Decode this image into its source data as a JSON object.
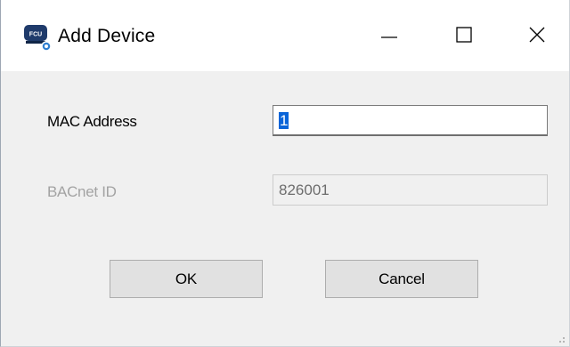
{
  "window": {
    "title": "Add Device",
    "icon_name": "fcu-device-icon",
    "icon_badge": "FCU",
    "controls": {
      "minimize_icon": "minimize-icon",
      "maximize_icon": "maximize-icon",
      "close_icon": "close-icon"
    }
  },
  "form": {
    "mac_address": {
      "label": "MAC Address",
      "value": "1"
    },
    "bacnet_id": {
      "label": "BACnet ID",
      "value": "826001"
    }
  },
  "buttons": {
    "ok_label": "OK",
    "cancel_label": "Cancel"
  },
  "colors": {
    "selection": "#0a64d8",
    "disabled_text": "#a3a3a3",
    "button_face": "#e1e1e1"
  }
}
